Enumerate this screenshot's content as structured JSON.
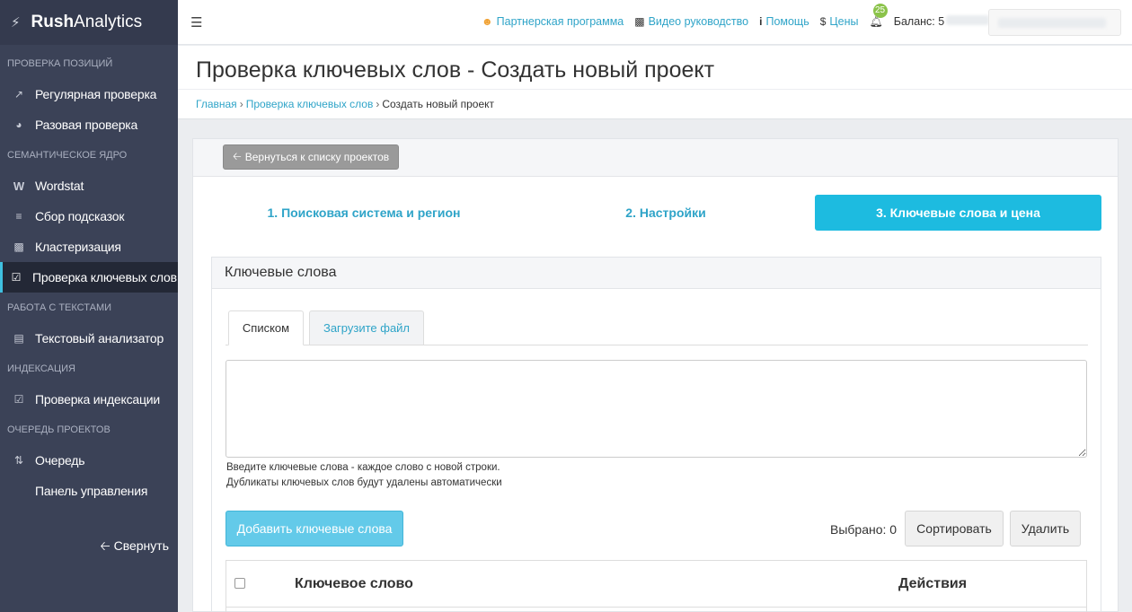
{
  "app": {
    "brand_bold": "Rush",
    "brand_rest": "Analytics"
  },
  "sidebar": {
    "sections": [
      {
        "title": "Проверка позиций",
        "items": [
          {
            "label": "Регулярная проверка",
            "icon": "line-chart-icon"
          },
          {
            "label": "Разовая проверка",
            "icon": "pie-chart-icon"
          }
        ]
      },
      {
        "title": "Семантическое ядро",
        "items": [
          {
            "label": "Wordstat",
            "icon": "wordstat-w-icon"
          },
          {
            "label": "Сбор подсказок",
            "icon": "align-left-icon"
          },
          {
            "label": "Кластеризация",
            "icon": "sitemap-icon"
          },
          {
            "label": "Проверка ключевых слов",
            "icon": "check-square-icon",
            "active": true
          }
        ]
      },
      {
        "title": "Работа с текстами",
        "items": [
          {
            "label": "Текстовый анализатор",
            "icon": "file-text-icon"
          }
        ]
      },
      {
        "title": "Индексация",
        "items": [
          {
            "label": "Проверка индексации",
            "icon": "check-square-icon"
          }
        ]
      },
      {
        "title": "Очередь проектов",
        "items": [
          {
            "label": "Очередь",
            "icon": "sort-numeric-icon"
          },
          {
            "label": "Панель управления",
            "icon": ""
          }
        ]
      }
    ],
    "collapse_label": "Свернуть"
  },
  "topbar": {
    "links": [
      {
        "label": "Партнерская программа",
        "icon": "users-icon"
      },
      {
        "label": "Видео руководство",
        "icon": "film-icon"
      },
      {
        "label": "Помощь",
        "icon": "info-icon"
      },
      {
        "label": "Цены",
        "icon": "dollar-icon"
      }
    ],
    "notifications_count": "25",
    "balance_label": "Баланс: 5"
  },
  "page": {
    "title": "Проверка ключевых слов - Создать новый проект",
    "breadcrumb": [
      "Главная",
      "Проверка ключевых слов",
      "Создать новый проект"
    ]
  },
  "panel": {
    "back_label": "Вернуться к списку проектов",
    "steps": [
      "1. Поисковая система и регион",
      "2. Настройки",
      "3. Ключевые слова и цена"
    ],
    "active_step": 3,
    "keywords": {
      "heading": "Ключевые слова",
      "tabs": [
        "Списком",
        "Загрузите файл"
      ],
      "textarea_value": "",
      "help_line1": "Введите ключевые слова - каждое слово с новой строки.",
      "help_line2": "Дубликаты ключевых слов будут удалены автоматически",
      "add_label": "Добавить ключевые слова",
      "selected_label": "Выбрано: 0",
      "sort_label": "Сортировать",
      "delete_label": "Удалить",
      "columns": [
        "Ключевое слово",
        "Действия"
      ]
    }
  },
  "colors": {
    "accent": "#1dbbe0",
    "sidebar_bg": "#3b4257",
    "link": "#2fa4c8"
  }
}
